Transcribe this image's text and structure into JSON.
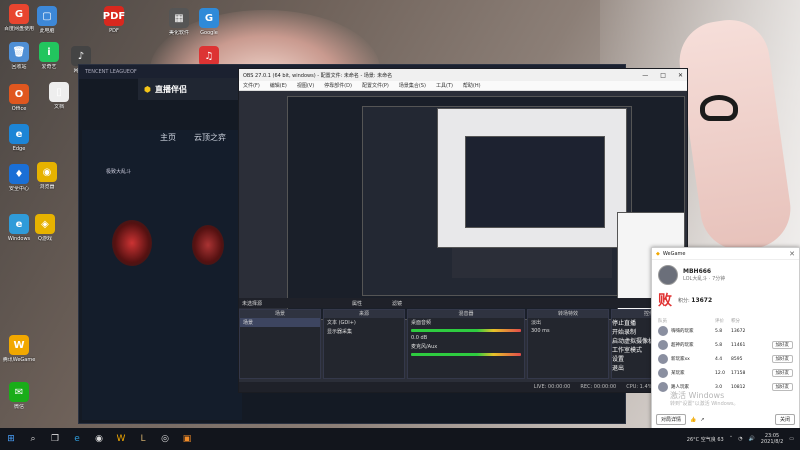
{
  "desktop": {
    "icons": [
      {
        "label": "百度网盘使用",
        "color": "#e8452f",
        "glyph": "G"
      },
      {
        "label": "此电脑\n应用",
        "color": "#3d88d8",
        "glyph": "▢"
      },
      {
        "label": "PDF\n中国银行",
        "color": "#d9281e",
        "glyph": "PDF"
      },
      {
        "label": "美化软件",
        "color": "#555",
        "glyph": "▦"
      },
      {
        "label": "Google\nChrome",
        "color": "#2f8ad8",
        "glyph": "G"
      },
      {
        "label": "回收站",
        "color": "#4f8fd5",
        "glyph": "🗑"
      },
      {
        "label": "爱奇艺",
        "color": "#22c55e",
        "glyph": "i"
      },
      {
        "label": "网易云",
        "color": "#444",
        "glyph": "♪"
      },
      {
        "label": "网易云音乐",
        "color": "#d33",
        "glyph": "♫"
      },
      {
        "label": "Office",
        "color": "#e0571f",
        "glyph": "O"
      },
      {
        "label": "文档",
        "color": "#eee",
        "glyph": "▯"
      },
      {
        "label": "Edge",
        "color": "#1d85d6",
        "glyph": "e"
      },
      {
        "label": "安全中心",
        "color": "#1a6fd6",
        "glyph": "♦"
      },
      {
        "label": "浏览器",
        "color": "#e6b200",
        "glyph": "◉"
      },
      {
        "label": "Windows\nEdge",
        "color": "#2f9bd9",
        "glyph": "e"
      },
      {
        "label": "Q游戏",
        "color": "#e6b200",
        "glyph": "◈"
      },
      {
        "label": "腾讯WeGame",
        "color": "#f2a800",
        "glyph": "W"
      },
      {
        "label": "微信",
        "color": "#1aad19",
        "glyph": "✉"
      }
    ],
    "watermark_line1": "激活 Windows",
    "watermark_line2": "转到\"设置\"以激活 Windows。"
  },
  "tencent": {
    "title": "TENCENT LEAGUEOF",
    "zbl_label": "直播伴侣",
    "tabs": [
      "主页",
      "云顶之弈"
    ],
    "sub_label": "极致大乱斗"
  },
  "obs": {
    "title": "OBS 27.0.1 (64 bit, windows) - 配置文件: 未命名 - 场景: 未命名",
    "menu": [
      "文件(F)",
      "编辑(E)",
      "视图(V)",
      "停靠部件(D)",
      "配置文件(P)",
      "场景集合(S)",
      "工具(T)",
      "帮助(H)"
    ],
    "scene_bar_label": "未选择源",
    "scene_bar_props": "属性",
    "scene_bar_filters": "滤镜",
    "panels": {
      "scenes": {
        "title": "场景",
        "items": [
          "场景"
        ]
      },
      "sources": {
        "title": "来源",
        "items": [
          "文本 (GDI+)",
          "显示器采集"
        ]
      },
      "mixer": {
        "title": "混音器",
        "tracks": [
          "桌面音频",
          "麦克风/Aux"
        ],
        "db": "0.0 dB"
      },
      "transitions": {
        "title": "转场特效",
        "type": "淡出",
        "duration": "300 ms"
      },
      "controls": {
        "title": "控件",
        "buttons": [
          "停止直播",
          "开始录制",
          "启动虚拟摄像机",
          "工作室模式",
          "设置",
          "退出"
        ]
      }
    },
    "status": {
      "live": "LIVE: 00:00:00",
      "rec": "REC: 00:00:00",
      "cpu": "CPU: 1.4%, 30.00 fps"
    }
  },
  "wegame": {
    "app_name": "WeGame",
    "username": "MBH666",
    "subtitle": "LOL大乱斗 · 7分钟",
    "result": "败",
    "score_label": "积分:",
    "score": "13672",
    "cols": [
      "队员",
      "评价",
      "积分",
      ""
    ],
    "rows": [
      {
        "name": "嗨嗨的玩家",
        "c1": "5.8",
        "c2": "13672",
        "btn": ""
      },
      {
        "name": "超神的玩家",
        "c1": "5.8",
        "c2": "11461",
        "btn": "加好友"
      },
      {
        "name": "新玩家xx",
        "c1": "4.4",
        "c2": "8595",
        "btn": "加好友"
      },
      {
        "name": "某玩家",
        "c1": "12.0",
        "c2": "17158",
        "btn": "加好友"
      },
      {
        "name": "路人玩家",
        "c1": "3.0",
        "c2": "10812",
        "btn": "加好友"
      }
    ],
    "footer_btn_left": "对局详情",
    "footer_btn_right": "关闭"
  },
  "taskbar": {
    "weather": "26°C 空气良 63",
    "time": "23:05",
    "date": "2021/8/2"
  }
}
